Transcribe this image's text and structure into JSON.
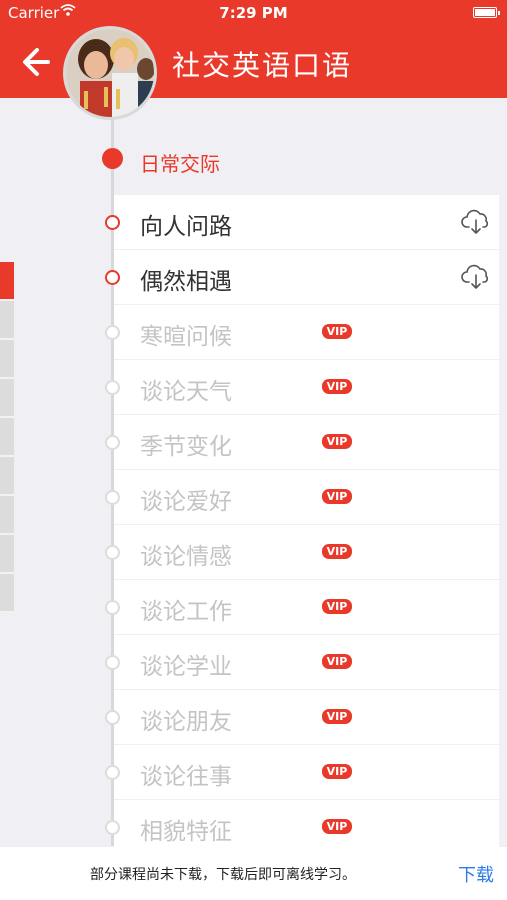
{
  "status_bar": {
    "carrier": "Carrier",
    "time": "7:29 PM",
    "wifi_icon": "wifi-icon",
    "battery_icon": "battery-icon"
  },
  "nav": {
    "title": "社交英语口语",
    "back_icon": "arrow-left-icon",
    "avatar_icon": "course-cover-photo"
  },
  "section": {
    "title": "日常交际"
  },
  "lessons": [
    {
      "label": "向人问路",
      "status": "available",
      "action_icon": "cloud-download-icon"
    },
    {
      "label": "偶然相遇",
      "status": "available",
      "action_icon": "cloud-download-icon"
    },
    {
      "label": "寒暄问候",
      "status": "locked",
      "badge": "VIP"
    },
    {
      "label": "谈论天气",
      "status": "locked",
      "badge": "VIP"
    },
    {
      "label": "季节变化",
      "status": "locked",
      "badge": "VIP"
    },
    {
      "label": "谈论爱好",
      "status": "locked",
      "badge": "VIP"
    },
    {
      "label": "谈论情感",
      "status": "locked",
      "badge": "VIP"
    },
    {
      "label": "谈论工作",
      "status": "locked",
      "badge": "VIP"
    },
    {
      "label": "谈论学业",
      "status": "locked",
      "badge": "VIP"
    },
    {
      "label": "谈论朋友",
      "status": "locked",
      "badge": "VIP"
    },
    {
      "label": "谈论往事",
      "status": "locked",
      "badge": "VIP"
    },
    {
      "label": "相貌特征",
      "status": "locked",
      "badge": "VIP"
    }
  ],
  "footer": {
    "message": "部分课程尚未下载，下载后即可离线学习。",
    "download_label": "下载"
  },
  "colors": {
    "accent": "#e8392b",
    "link": "#2b7de9",
    "background": "#efeff4"
  }
}
